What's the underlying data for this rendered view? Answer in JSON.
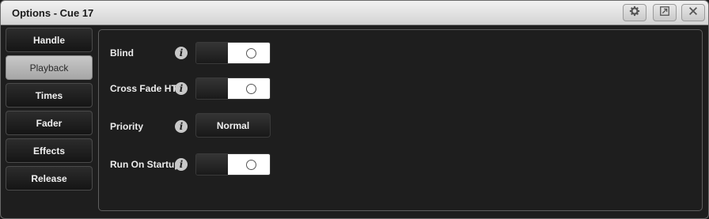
{
  "window": {
    "title": "Options - Cue 17",
    "buttons": [
      {
        "name": "settings",
        "icon": "gear-icon"
      },
      {
        "name": "restore",
        "icon": "restore-icon"
      },
      {
        "name": "close",
        "icon": "close-icon"
      }
    ]
  },
  "sidebar": {
    "items": [
      {
        "label": "Handle",
        "active": false
      },
      {
        "label": "Playback",
        "active": true
      },
      {
        "label": "Times",
        "active": false
      },
      {
        "label": "Fader",
        "active": false
      },
      {
        "label": "Effects",
        "active": false
      },
      {
        "label": "Release",
        "active": false
      }
    ]
  },
  "options": {
    "blind": {
      "label": "Blind",
      "state": "off"
    },
    "cross_fade_htp": {
      "label": "Cross Fade HTP",
      "state": "off"
    },
    "priority": {
      "label": "Priority",
      "value": "Normal"
    },
    "run_on_startup": {
      "label": "Run On Startup",
      "state": "off"
    }
  },
  "colors": {
    "background": "#1e1e1e",
    "titlebar": "#e0e0e0",
    "active_tab": "#b8b8b8",
    "toggle_on_side": "#ffffff"
  }
}
